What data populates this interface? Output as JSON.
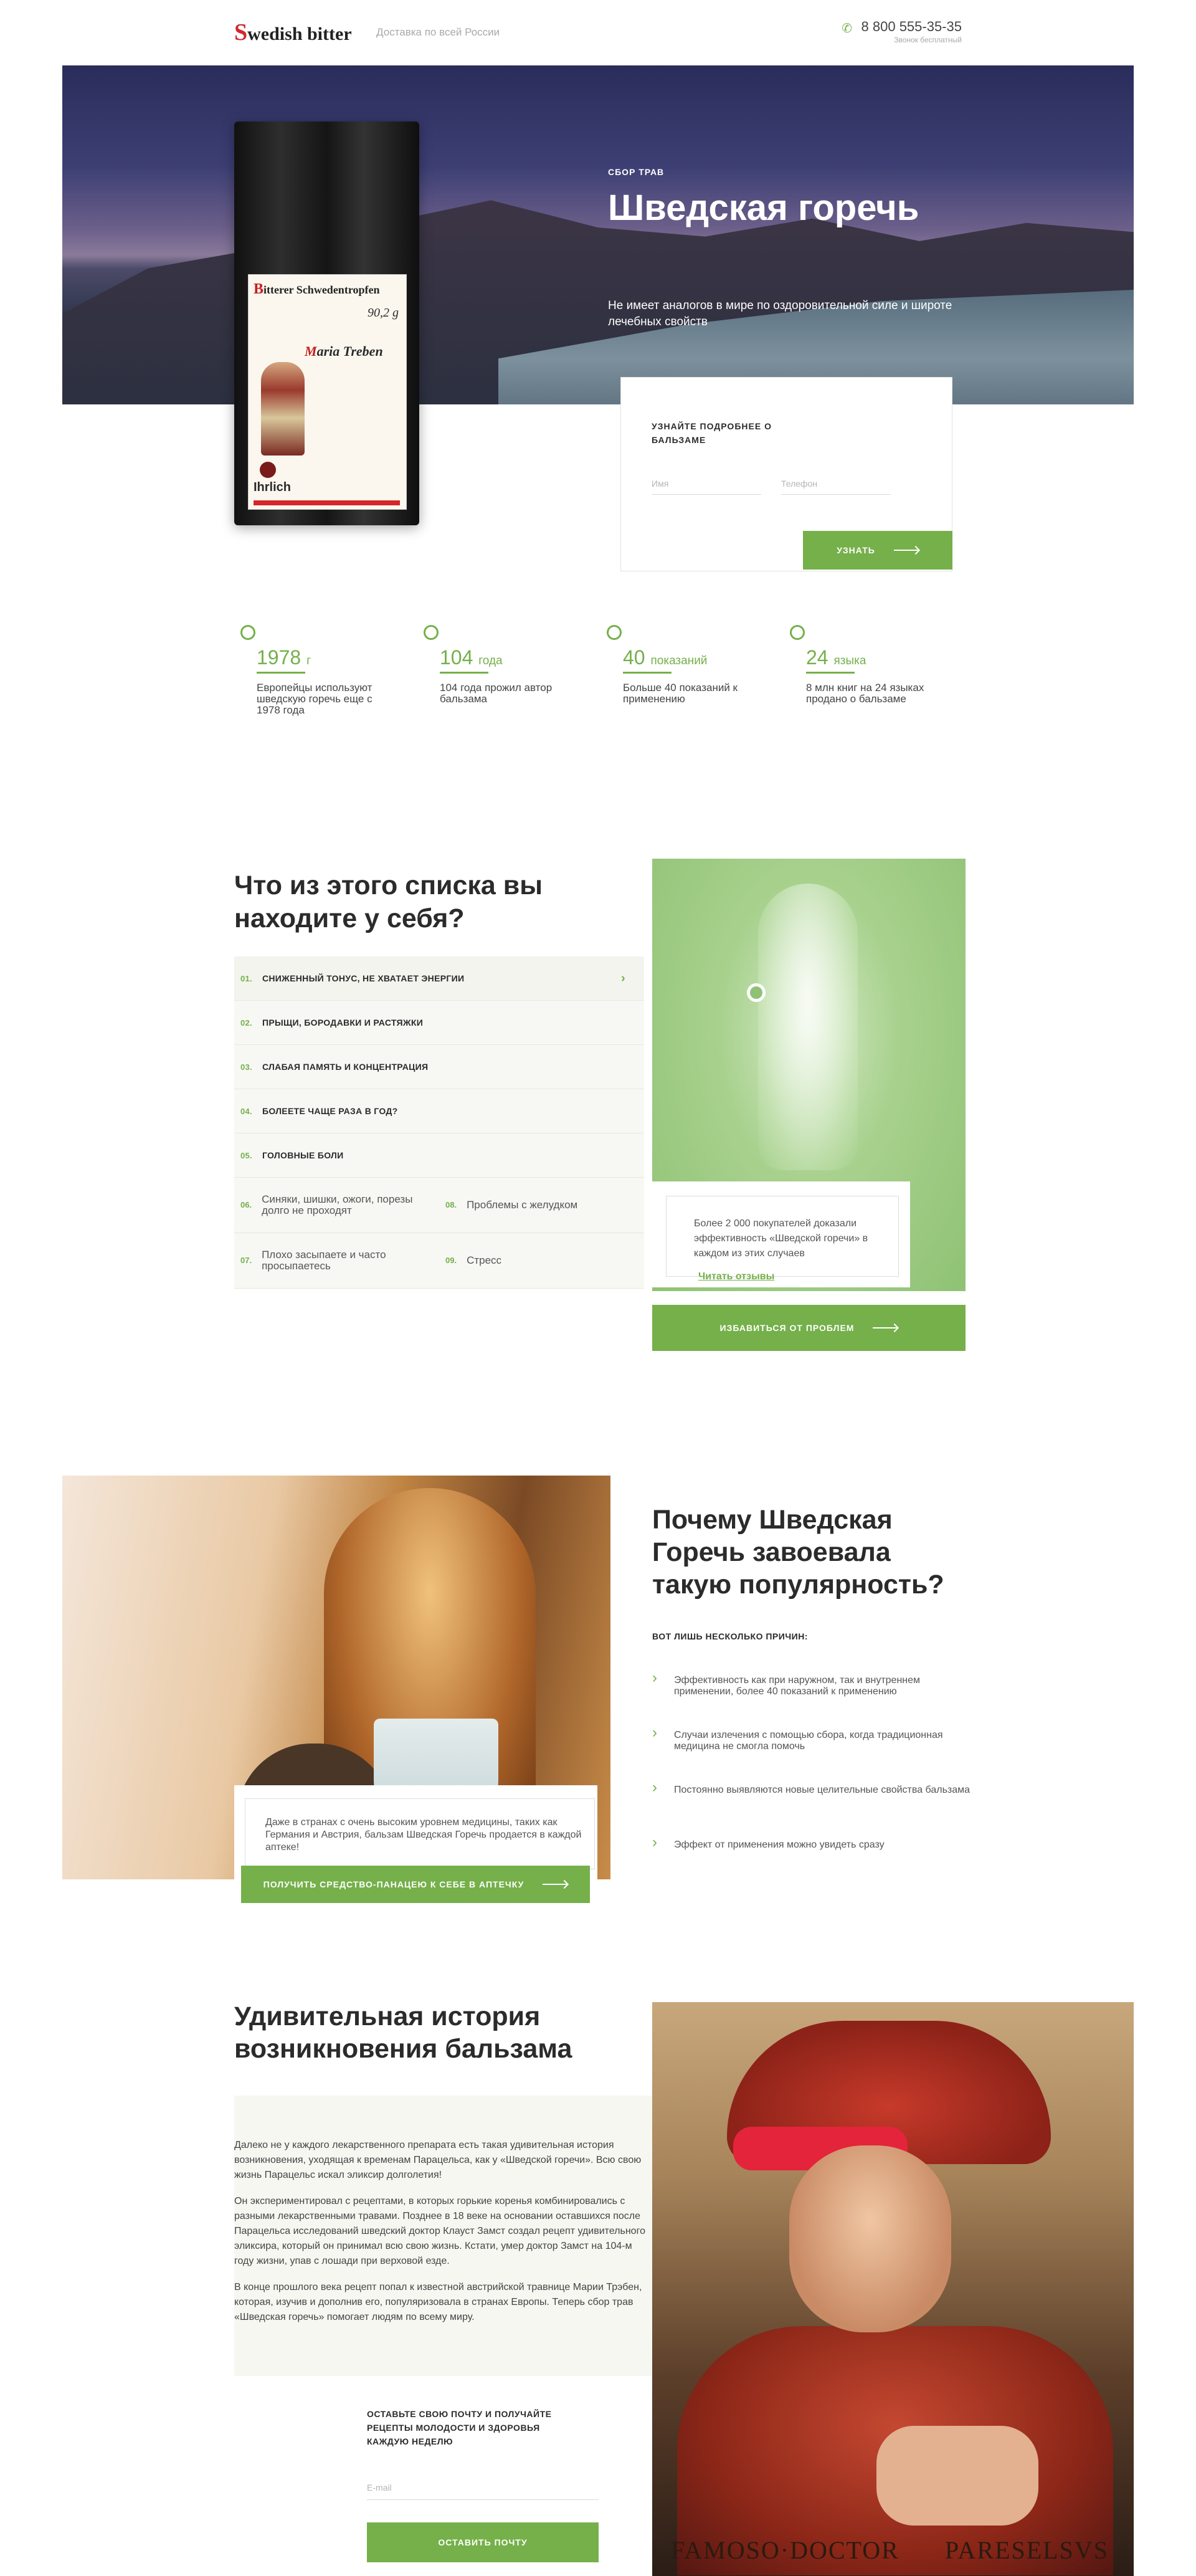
{
  "header": {
    "logo": "Swedish bitter",
    "delivery": "Доставка по всей России",
    "phone": "8 800 555-35-35",
    "phone_note": "Звонок бесплатный"
  },
  "hero": {
    "tag": "СБОР ТРАВ",
    "title": "Шведская горечь",
    "subtitle": "Не имеет аналогов в мире по оздоровительной силе и широте лечебных свойств",
    "package": {
      "label_title": "Bitterer Schwedentropfen",
      "weight": "90,2 g",
      "author": "Maria Treben",
      "brand": "Ihrlich"
    },
    "form": {
      "title": "УЗНАЙТЕ ПОДРОБНЕЕ О БАЛЬЗАМЕ",
      "name_placeholder": "Имя",
      "phone_placeholder": "Телефон",
      "button": "УЗНАТЬ"
    }
  },
  "stats": [
    {
      "num": "1978",
      "unit": "г",
      "desc": "Европейцы используют шведскую горечь еще с 1978 года"
    },
    {
      "num": "104",
      "unit": "года",
      "desc": "104 года прожил автор бальзама"
    },
    {
      "num": "40",
      "unit": "показаний",
      "desc": "Больше 40 показаний к применению"
    },
    {
      "num": "24",
      "unit": "языка",
      "desc": "8 млн книг на 24 языках продано о бальзаме"
    }
  ],
  "symptoms": {
    "title": "Что из этого списка вы находите у себя?",
    "rows": [
      {
        "n": "01.",
        "label": "СНИЖЕННЫЙ ТОНУС, НЕ ХВАТАЕТ ЭНЕРГИИ"
      },
      {
        "n": "02.",
        "label": "ПРЫЩИ, БОРОДАВКИ И РАСТЯЖКИ"
      },
      {
        "n": "03.",
        "label": "СЛАБАЯ ПАМЯТЬ И КОНЦЕНТРАЦИЯ"
      },
      {
        "n": "04.",
        "label": "БОЛЕЕТЕ ЧАЩЕ РАЗА В ГОД?"
      },
      {
        "n": "05.",
        "label": "ГОЛОВНЫЕ БОЛИ"
      }
    ],
    "grid": [
      {
        "n": "06.",
        "label": "Синяки, шишки, ожоги, порезы долго не проходят"
      },
      {
        "n": "08.",
        "label": "Проблемы с желудком"
      },
      {
        "n": "07.",
        "label": "Плохо засыпаете и часто просыпаетесь"
      },
      {
        "n": "09.",
        "label": "Стресс"
      }
    ],
    "quote": "Более 2 000 покупателей доказали эффективность «Шведской горечи» в каждом из этих случаев",
    "quote_link": "Читать отзывы",
    "button": "ИЗБАВИТЬСЯ ОТ ПРОБЛЕМ"
  },
  "popularity": {
    "title": "Почему Шведская Горечь завоевала такую популярность?",
    "subtitle": "ВОТ ЛИШЬ НЕСКОЛЬКО ПРИЧИН:",
    "reasons": [
      "Эффективность как при наружном, так и внутреннем применении, более 40 показаний к применению",
      "Случаи излечения с помощью сбора, когда традиционная медицина не смогла помочь",
      "Постоянно выявляются новые целительные свойства бальзама",
      "Эффект от применения можно увидеть сразу"
    ],
    "quote": "Даже в странах с очень высоким уровнем медицины, таких как Германия и Австрия, бальзам Шведская Горечь продается в каждой аптеке!",
    "button": "ПОЛУЧИТЬ СРЕДСТВО-ПАНАЦЕЮ К СЕБЕ В АПТЕЧКУ"
  },
  "history": {
    "title": "Удивительная история возникновения бальзама",
    "paragraphs": [
      "Далеко не у каждого лекарственного препарата есть такая удивительная история возникновения, уходящая к временам Парацельса, как у «Шведской горечи». Всю свою жизнь Парацельс искал эликсир долголетия!",
      "Он экспериментировал с рецептами, в которых горькие коренья комбинировались с разными лекарственными травами. Позднее в 18 веке на основании оставшихся после Парацельса исследований шведский доктор Клауст Замст создал рецепт удивительного эликсира, который он принимал всю свою жизнь. Кстати, умер доктор Замст на 104-м году жизни, упав с лошади при верховой езде.",
      "В конце прошлого века рецепт попал к известной австрийской травнице Марии Трэбен, которая, изучив и дополнив его, популяризовала в странах Европы. Теперь сбор трав «Шведская горечь» помогает людям по всему миру."
    ],
    "portrait_inscription_left": "FAMOSO·DOCTOR",
    "portrait_inscription_right": "PARESELSVS",
    "subscribe_title": "ОСТАВЬТЕ СВОЮ ПОЧТУ И ПОЛУЧАЙТЕ РЕЦЕПТЫ МОЛОДОСТИ И ЗДОРОВЬЯ КАЖДУЮ НЕДЕЛЮ",
    "email_placeholder": "E-mail",
    "button": "ОСТАВИТЬ ПОЧТУ"
  },
  "colors": {
    "accent": "#75b04a",
    "text": "#2b2b2b",
    "panel": "#f7f8f4"
  }
}
